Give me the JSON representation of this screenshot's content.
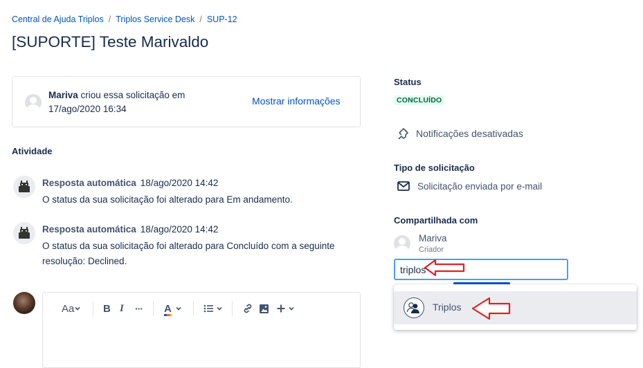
{
  "breadcrumb": {
    "items": [
      "Central de Ajuda Triplos",
      "Triplos Service Desk",
      "SUP-12"
    ],
    "separator": "/"
  },
  "title": "[SUPORTE] Teste Marivaldo",
  "request_info": {
    "creator": "Mariva",
    "created_text": "criou essa solicitação em",
    "created_date": "17/ago/2020 16:34",
    "show_more_label": "Mostrar informações"
  },
  "activity": {
    "title": "Atividade",
    "entries": [
      {
        "author": "Resposta automática",
        "time": "18/ago/2020 14:42",
        "message": "O status da sua solicitação foi alterado para Em andamento."
      },
      {
        "author": "Resposta automática",
        "time": "18/ago/2020 14:42",
        "message": "O status da sua solicitação foi alterado para Concluído com a seguinte resolução: Declined."
      }
    ]
  },
  "editor": {
    "text_style_label": "Aa",
    "bold_label": "B",
    "italic_label": "I",
    "more_label": "···",
    "color_label": "A"
  },
  "sidebar": {
    "status_title": "Status",
    "status_value": "CONCLUÍDO",
    "notifications_label": "Notificações desativadas",
    "request_type_title": "Tipo de solicitação",
    "request_type_value": "Solicitação enviada por e-mail",
    "shared_title": "Compartilhada com",
    "shared_user_name": "Mariva",
    "shared_user_role": "Criador",
    "share_input_value": "triplos",
    "dropdown_option": "Triplos"
  },
  "colors": {
    "link": "#0052cc",
    "text": "#172b4d",
    "status_bg": "#e3fcef",
    "status_text": "#006644",
    "focus_border": "#4c9aff",
    "annotation_arrow": "#e0201f"
  }
}
